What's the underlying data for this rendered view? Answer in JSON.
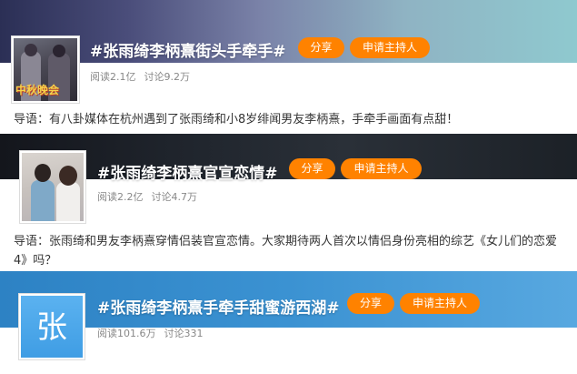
{
  "topics": [
    {
      "title": "#张雨绮李柄熹街头手牵手#",
      "share_label": "分享",
      "host_label": "申请主持人",
      "reads": "阅读2.1亿",
      "discussions": "讨论9.2万",
      "intro": "导语：有八卦媒体在杭州遇到了张雨绮和小8岁绯闻男友李柄熹，手牵手画面有点甜！",
      "thumb_caption": "中秋晚会"
    },
    {
      "title": "#张雨绮李柄熹官宣恋情#",
      "share_label": "分享",
      "host_label": "申请主持人",
      "reads": "阅读2.2亿",
      "discussions": "讨论4.7万",
      "intro": "导语：张雨绮和男友李柄熹穿情侣装官宣恋情。大家期待两人首次以情侣身份亮相的综艺《女儿们的恋爱4》吗？"
    },
    {
      "title": "#张雨绮李柄熹手牵手甜蜜游西湖#",
      "share_label": "分享",
      "host_label": "申请主持人",
      "reads": "阅读101.6万",
      "discussions": "讨论331",
      "thumb_char": "张"
    }
  ]
}
